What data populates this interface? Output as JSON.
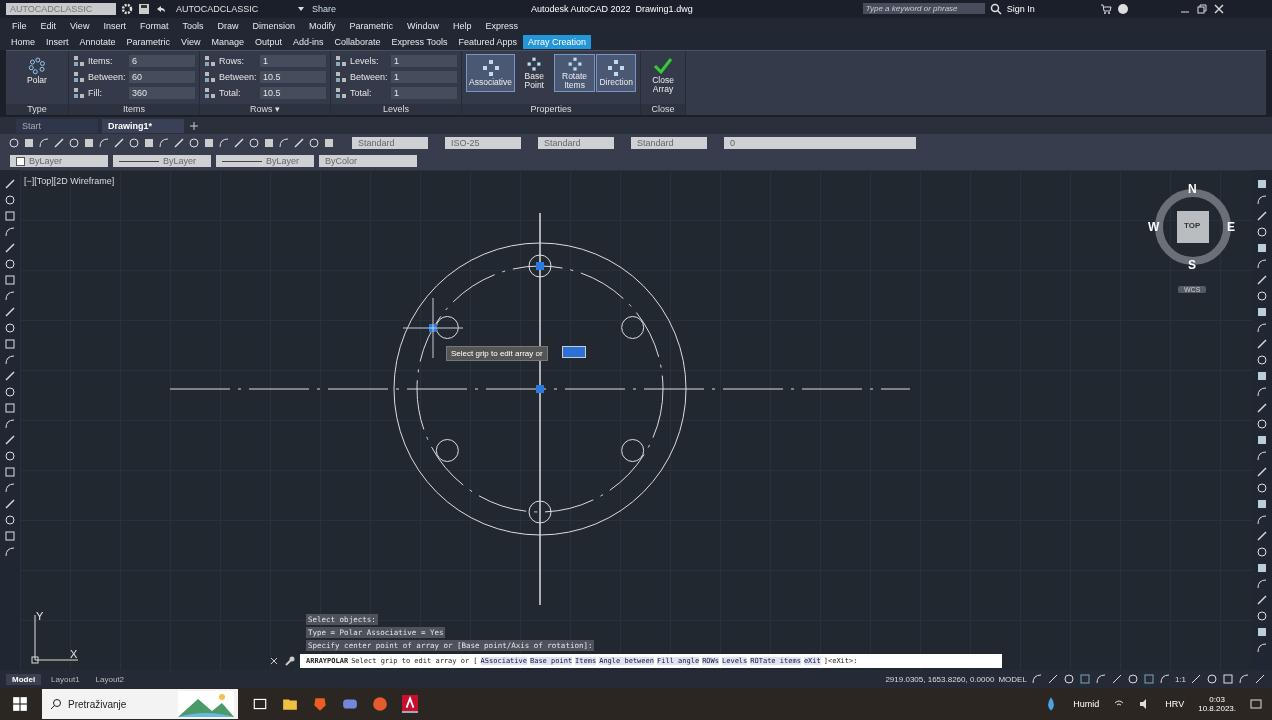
{
  "quick_access": {
    "workspace": "AUTOCADCLASSIC",
    "workspace_switch": "AUTOCADCLASSIC",
    "share": "Share"
  },
  "window": {
    "title": "Autodesk AutoCAD 2022",
    "filename": "Drawing1.dwg"
  },
  "search": {
    "placeholder": "Type a keyword or phrase"
  },
  "sign_in": "Sign In",
  "menu": [
    "File",
    "Edit",
    "View",
    "Insert",
    "Format",
    "Tools",
    "Draw",
    "Dimension",
    "Modify",
    "Parametric",
    "Window",
    "Help",
    "Express"
  ],
  "ribbon_tabs": [
    {
      "label": "Home",
      "selected": false
    },
    {
      "label": "Insert",
      "selected": false
    },
    {
      "label": "Annotate",
      "selected": false
    },
    {
      "label": "Parametric",
      "selected": false
    },
    {
      "label": "View",
      "selected": false
    },
    {
      "label": "Manage",
      "selected": false
    },
    {
      "label": "Output",
      "selected": false
    },
    {
      "label": "Add-ins",
      "selected": false
    },
    {
      "label": "Collaborate",
      "selected": false
    },
    {
      "label": "Express Tools",
      "selected": false
    },
    {
      "label": "Featured Apps",
      "selected": false
    },
    {
      "label": "Array Creation",
      "selected": true
    }
  ],
  "ribbon": {
    "type_panel": {
      "button": "Polar",
      "label": "Type"
    },
    "panels": [
      {
        "label": "Items",
        "fields": [
          {
            "label": "Items:",
            "value": "6"
          },
          {
            "label": "Between:",
            "value": "60"
          },
          {
            "label": "Fill:",
            "value": "360"
          }
        ]
      },
      {
        "label": "Rows ▾",
        "fields": [
          {
            "label": "Rows:",
            "value": "1"
          },
          {
            "label": "Between:",
            "value": "10.5"
          },
          {
            "label": "Total:",
            "value": "10.5"
          }
        ]
      },
      {
        "label": "Levels",
        "fields": [
          {
            "label": "Levels:",
            "value": "1"
          },
          {
            "label": "Between:",
            "value": "1"
          },
          {
            "label": "Total:",
            "value": "1"
          }
        ]
      }
    ],
    "properties": {
      "label": "Properties",
      "buttons": [
        {
          "label": "Associative",
          "selected": true
        },
        {
          "label": "Base Point",
          "selected": false
        },
        {
          "label": "Rotate Items",
          "selected": true
        },
        {
          "label": "Direction",
          "selected": true
        }
      ]
    },
    "close": {
      "button": "Close Array",
      "label": "Close"
    }
  },
  "file_tabs": [
    {
      "label": "Start",
      "selected": false
    },
    {
      "label": "Drawing1*",
      "selected": true
    }
  ],
  "styles": [
    "Standard",
    "ISO-25",
    "Standard",
    "Standard"
  ],
  "layer": "0",
  "properties_bar": [
    {
      "kind": "color",
      "label": "ByLayer"
    },
    {
      "kind": "line",
      "label": "ByLayer"
    },
    {
      "kind": "line",
      "label": "ByLayer"
    },
    {
      "kind": "plain",
      "label": "ByColor"
    }
  ],
  "viewport": {
    "label": "[−][Top][2D Wireframe]",
    "tooltip": "Select grip to edit array or"
  },
  "viewcube": {
    "top": "TOP",
    "north": "N",
    "south": "S",
    "east": "E",
    "west": "W",
    "ucs": "WCS"
  },
  "ucs_icon": {
    "x": "X",
    "y": "Y"
  },
  "command_history": [
    "Select objects:",
    "Type = Polar  Associative = Yes",
    "Specify center point of array or [Base point/Axis of rotation]:"
  ],
  "command_line": {
    "command": "ARRAYPOLAR",
    "prompt": "Select grip to edit array or [",
    "options": [
      "ASsociative",
      "Base point",
      "Items",
      "Angle between",
      "Fill angle",
      "ROWs",
      "Levels",
      "ROTate items",
      "eXit"
    ],
    "end": "]<eXit>:"
  },
  "layout_tabs": [
    {
      "label": "Model",
      "selected": true
    },
    {
      "label": "Layout1",
      "selected": false
    },
    {
      "label": "Layout2",
      "selected": false
    }
  ],
  "status_bar": {
    "coordinates": "2919.0305, 1653.8260, 0.0000",
    "space": "MODEL",
    "scale": "1:1"
  },
  "taskbar": {
    "search_placeholder": "Pretraživanje",
    "weather": "Humid",
    "language": "HRV",
    "time": "0:03",
    "date": "10.8.2023."
  }
}
